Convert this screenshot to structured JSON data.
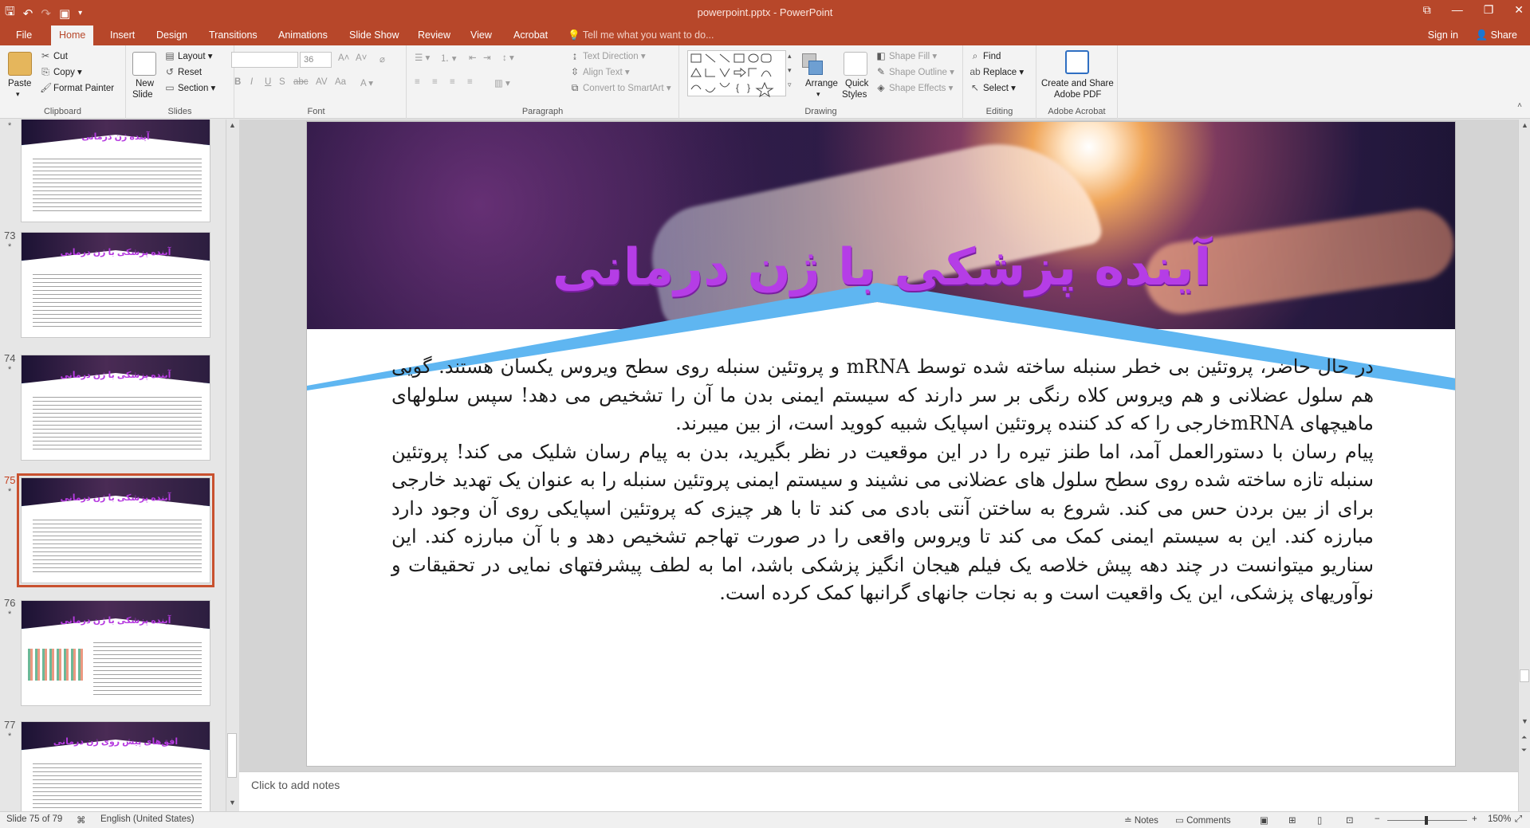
{
  "app": {
    "window_title": "powerpoint.pptx - PowerPoint"
  },
  "tabs": [
    "File",
    "Home",
    "Insert",
    "Design",
    "Transitions",
    "Animations",
    "Slide Show",
    "Review",
    "View",
    "Acrobat"
  ],
  "tell_me": "Tell me what you want to do...",
  "account": {
    "sign_in": "Sign in",
    "share": "Share"
  },
  "ribbon": {
    "clipboard": {
      "label": "Clipboard",
      "paste": "Paste",
      "cut": "Cut",
      "copy": "Copy",
      "format_painter": "Format Painter"
    },
    "slides": {
      "label": "Slides",
      "new_slide": "New",
      "new_slide_2": "Slide",
      "layout": "Layout",
      "reset": "Reset",
      "section": "Section"
    },
    "font": {
      "label": "Font",
      "font_name": "",
      "font_size": "36"
    },
    "paragraph": {
      "label": "Paragraph",
      "text_direction": "Text Direction",
      "align_text": "Align Text",
      "convert_smartart": "Convert to SmartArt"
    },
    "drawing": {
      "label": "Drawing",
      "arrange": "Arrange",
      "quick_styles": "Quick",
      "quick_styles_2": "Styles",
      "shape_fill": "Shape Fill",
      "shape_outline": "Shape Outline",
      "shape_effects": "Shape Effects"
    },
    "editing": {
      "label": "Editing",
      "find": "Find",
      "replace": "Replace",
      "select": "Select"
    },
    "acrobat": {
      "label": "Adobe Acrobat",
      "create_share": "Create and Share",
      "create_share_2": "Adobe PDF"
    }
  },
  "thumbnails": [
    {
      "num": "",
      "title": "آینده ژن درمانی"
    },
    {
      "num": "73",
      "title": "آینده پزشکی با ژن درمانی"
    },
    {
      "num": "74",
      "title": "آینده پزشکی با ژن درمانی"
    },
    {
      "num": "75",
      "title": "آینده پزشکی با ژن درمانی"
    },
    {
      "num": "76",
      "title": "آینده پزشکی با ژن درمانی"
    },
    {
      "num": "77",
      "title": "افق‌های پیش روی ژن درمانی"
    }
  ],
  "slide": {
    "title": "آینده پزشکی با ژن درمانی",
    "paragraph1": "در حال حاضر، پروتئین بی خطر سنبله ساخته شده توسط  mRNA و پروتئین سنبله روی سطح ویروس یکسان هستند. گویی هم سلول عضلانی و هم ویروس کلاه رنگی بر سر دارند که سیستم ایمنی بدن ما آن را تشخیص می دهد! سپس سلولهای ماهیچهای  mRNAخارجی را که کد کننده پروتئین اسپایک شبیه کووید است، از بین میبرند.",
    "paragraph2": "پیام رسان با دستورالعمل آمد، اما طنز تیره را در این موقعیت در نظر بگیرید، بدن به پیام رسان شلیک می کند! پروتئین سنبله تازه ساخته شده روی سطح سلول های عضلانی می نشیند و سیستم ایمنی پروتئین سنبله را به عنوان یک تهدید خارجی برای از بین بردن حس می کند. شروع به ساختن آنتی بادی می کند تا با هر چیزی که پروتئین اسپایکی روی آن وجود دارد مبارزه کند. این به سیستم ایمنی کمک می کند تا ویروس واقعی را در صورت تهاجم تشخیص دهد و با آن مبارزه کند. این سناریو میتوانست در چند دهه پیش خلاصه یک فیلم هیجان انگیز پزشکی باشد، اما به لطف پیشرفتهای نمایی در تحقیقات و نوآوریهای پزشکی، این یک واقعیت است و به نجات جانهای گرانبها کمک کرده است."
  },
  "notes_placeholder": "Click to add notes",
  "status": {
    "slide_info": "Slide 75 of 79",
    "language": "English (United States)",
    "notes": "Notes",
    "comments": "Comments",
    "zoom": "150%"
  },
  "colors": {
    "accent": "#b7472a",
    "title_purple": "#b53de6",
    "band_blue": "#5fb6f1"
  }
}
